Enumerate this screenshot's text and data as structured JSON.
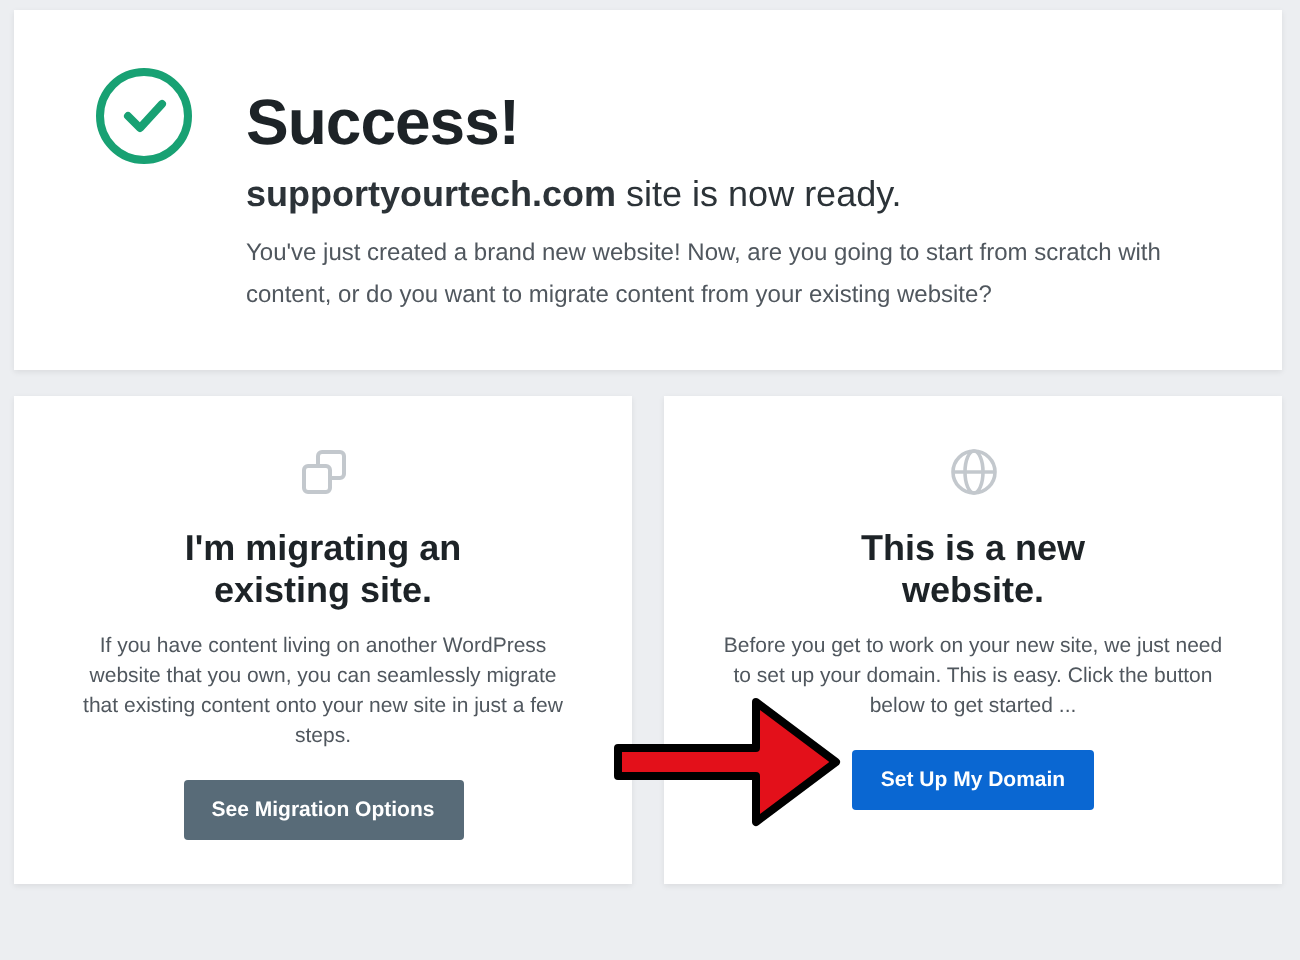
{
  "success": {
    "title": "Success!",
    "message": "**supportyourtech.com** site is now ready.",
    "description": "You've just created a brand new website! Now, are you going to start from scratch with content, or do you want to migrate content from your existing website?"
  },
  "options": [
    {
      "kind": "migrate",
      "title": "I'm migrating an existing site.",
      "description": "If you have content living on another WordPress website that you own, you can seamlessly migrate that existing content onto your new site in just a few steps.",
      "button": "See Migration Options"
    },
    {
      "kind": "new",
      "title": "This is a new website.",
      "description": "Before you get to work on your new site, we just need to set up your domain. This is easy. Click the button below to get started ...",
      "button": "Set Up My Domain"
    }
  ]
}
